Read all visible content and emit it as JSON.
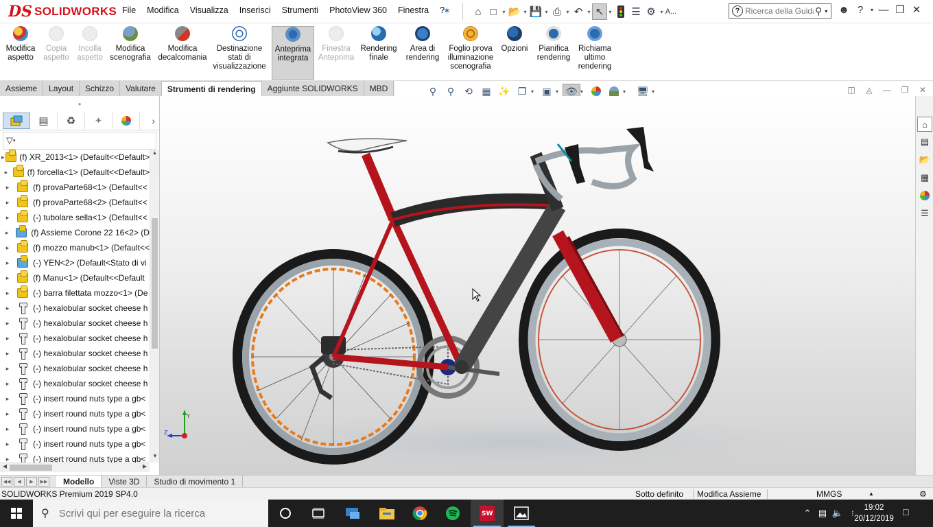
{
  "app": {
    "logo_ds": "DS",
    "logo_name": "SOLIDWORKS",
    "menus": [
      "File",
      "Modifica",
      "Visualizza",
      "Inserisci",
      "Strumenti",
      "PhotoView 360",
      "Finestra",
      "?"
    ],
    "search_placeholder": "Ricerca della Guida",
    "user_initial": "A...",
    "accent": "#d4121b"
  },
  "ribbon": {
    "buttons": [
      {
        "label": "Modifica\naspetto",
        "icon": "appearance-icon",
        "state": "normal"
      },
      {
        "label": "Copia\naspetto",
        "icon": "copy-appearance-icon",
        "state": "disabled"
      },
      {
        "label": "Incolla\naspetto",
        "icon": "paste-appearance-icon",
        "state": "disabled"
      },
      {
        "label": "Modifica\nscenografia",
        "icon": "scene-icon",
        "state": "normal"
      },
      {
        "label": "Modifica\ndecalcomania",
        "icon": "decal-icon",
        "state": "normal"
      },
      {
        "label": "Destinazione\nstati di\nvisualizzazione",
        "icon": "target-icon",
        "state": "normal"
      },
      {
        "label": "Anteprima\nintegrata",
        "icon": "integrated-preview-icon",
        "state": "active"
      },
      {
        "label": "Finestra\nAnteprima",
        "icon": "preview-window-icon",
        "state": "disabled"
      },
      {
        "label": "Rendering\nfinale",
        "icon": "final-render-icon",
        "state": "normal"
      },
      {
        "label": "Area di\nrendering",
        "icon": "render-region-icon",
        "state": "normal"
      },
      {
        "label": "Foglio prova\nilluminazione\nscenografia",
        "icon": "proof-sheet-icon",
        "state": "normal"
      },
      {
        "label": "Opzioni",
        "icon": "options-icon",
        "state": "normal"
      },
      {
        "label": "Pianifica\nrendering",
        "icon": "schedule-render-icon",
        "state": "normal"
      },
      {
        "label": "Richiama\nultimo\nrendering",
        "icon": "recall-render-icon",
        "state": "normal"
      }
    ]
  },
  "command_tabs": [
    "Assieme",
    "Layout",
    "Schizzo",
    "Valutare",
    "Strumenti di rendering",
    "Aggiunte SOLIDWORKS",
    "MBD"
  ],
  "command_tab_active": "Strumenti di rendering",
  "tree": [
    {
      "label": "(f) XR_2013<1> (Default<<Default>",
      "icon": "assembly-icon"
    },
    {
      "label": "(f) forcella<1> (Default<<Default>",
      "icon": "assembly-icon"
    },
    {
      "label": "(f) provaParte68<1> (Default<<",
      "icon": "assembly-icon"
    },
    {
      "label": "(f) provaParte68<2> (Default<<",
      "icon": "assembly-icon"
    },
    {
      "label": "(-) tubolare sella<1> (Default<<",
      "icon": "assembly-icon"
    },
    {
      "label": "(f) Assieme Corone 22 16<2> (D",
      "icon": "subassembly-icon"
    },
    {
      "label": "(f) mozzo manub<1> (Default<<",
      "icon": "assembly-icon"
    },
    {
      "label": "(-) YEN<2> (Default<Stato di vi",
      "icon": "subassembly-icon"
    },
    {
      "label": "(f) Manu<1> (Default<<Default",
      "icon": "assembly-icon"
    },
    {
      "label": "(-) barra filettata mozzo<1> (De",
      "icon": "assembly-icon"
    },
    {
      "label": "(-) hexalobular socket cheese h",
      "icon": "bolt-icon"
    },
    {
      "label": "(-) hexalobular socket cheese h",
      "icon": "bolt-icon"
    },
    {
      "label": "(-) hexalobular socket cheese h",
      "icon": "bolt-icon"
    },
    {
      "label": "(-) hexalobular socket cheese h",
      "icon": "bolt-icon"
    },
    {
      "label": "(-) hexalobular socket cheese h",
      "icon": "bolt-icon"
    },
    {
      "label": "(-) hexalobular socket cheese h",
      "icon": "bolt-icon"
    },
    {
      "label": "(-) insert round nuts type a gb<",
      "icon": "bolt-icon"
    },
    {
      "label": "(-) insert round nuts type a gb<",
      "icon": "bolt-icon"
    },
    {
      "label": "(-) insert round nuts type a gb<",
      "icon": "bolt-icon"
    },
    {
      "label": "(-) insert round nuts type a gb<",
      "icon": "bolt-icon"
    },
    {
      "label": "(-) insert round nuts type a gb<",
      "icon": "bolt-icon"
    }
  ],
  "bottom_tabs": [
    "Modello",
    "Viste 3D",
    "Studio di movimento 1"
  ],
  "bottom_tab_active": "Modello",
  "status": {
    "product": "SOLIDWORKS Premium 2019 SP4.0",
    "definition": "Sotto definito",
    "mode": "Modifica Assieme",
    "units": "MMGS"
  },
  "taskbar": {
    "search_placeholder": "Scrivi qui per eseguire la ricerca",
    "time": "19:02",
    "date": "20/12/2019"
  },
  "colors": {
    "frame_red": "#b5141c",
    "frame_grey": "#3f3f3f",
    "rim_orange": "#e77a1d",
    "taskbar": "#1e1e1e"
  }
}
